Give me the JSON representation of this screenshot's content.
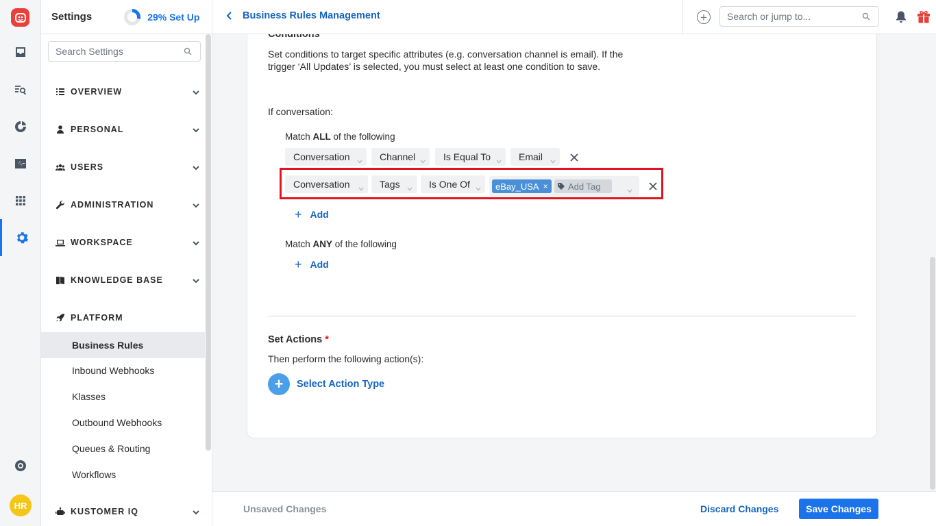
{
  "app": {
    "logo_text": "HR",
    "user_initials": "HR",
    "accent_color": "#1a73e8",
    "avatar_color": "#f5c518"
  },
  "rail": {
    "icons": [
      "inbox-icon",
      "search-list-icon",
      "reports-icon",
      "activity-icon",
      "apps-grid-icon",
      "settings-gear-icon",
      "help-lifebuoy-icon"
    ],
    "active": "settings-gear-icon"
  },
  "sidebar": {
    "title": "Settings",
    "setup_progress_label": "29% Set Up",
    "setup_progress": 0.29,
    "search_placeholder": "Search Settings",
    "groups": [
      {
        "label": "OVERVIEW",
        "icon": "list-icon"
      },
      {
        "label": "PERSONAL",
        "icon": "person-icon"
      },
      {
        "label": "USERS",
        "icon": "users-icon"
      },
      {
        "label": "ADMINISTRATION",
        "icon": "wrench-icon"
      },
      {
        "label": "WORKSPACE",
        "icon": "laptop-icon"
      },
      {
        "label": "KNOWLEDGE BASE",
        "icon": "book-icon"
      },
      {
        "label": "PLATFORM",
        "icon": "rocket-icon"
      },
      {
        "label": "KUSTOMER IQ",
        "icon": "robot-icon"
      }
    ],
    "platform_items": [
      "Business Rules",
      "Inbound Webhooks",
      "Klasses",
      "Outbound Webhooks",
      "Queues & Routing",
      "Workflows"
    ],
    "active_item": "Business Rules"
  },
  "topbar": {
    "breadcrumb": "Business Rules Management",
    "search_placeholder": "Search or jump to..."
  },
  "conditions": {
    "heading": "Conditions",
    "description": "Set conditions to target specific attributes (e.g. conversation channel is email). If the trigger ‘All Updates’ is selected, you must select at least one condition to save.",
    "if_label": "If conversation:",
    "match_all_prefix": "Match ",
    "match_all_word": "ALL",
    "match_suffix": " of the following",
    "match_any_word": "ANY",
    "row1": {
      "object": "Conversation",
      "field": "Channel",
      "operator": "Is Equal To",
      "value": "Email"
    },
    "row2": {
      "object": "Conversation",
      "field": "Tags",
      "operator": "Is One Of",
      "tag": "eBay_USA",
      "tag_remove": "×",
      "add_tag_placeholder": "Add Tag"
    },
    "add_label": "Add",
    "add_plus": "+"
  },
  "actions": {
    "heading": "Set Actions",
    "required_mark": "*",
    "description": "Then perform the following action(s):",
    "select_label": "Select Action Type",
    "select_plus": "+"
  },
  "footer": {
    "status": "Unsaved Changes",
    "discard_label": "Discard Changes",
    "save_label": "Save Changes"
  }
}
